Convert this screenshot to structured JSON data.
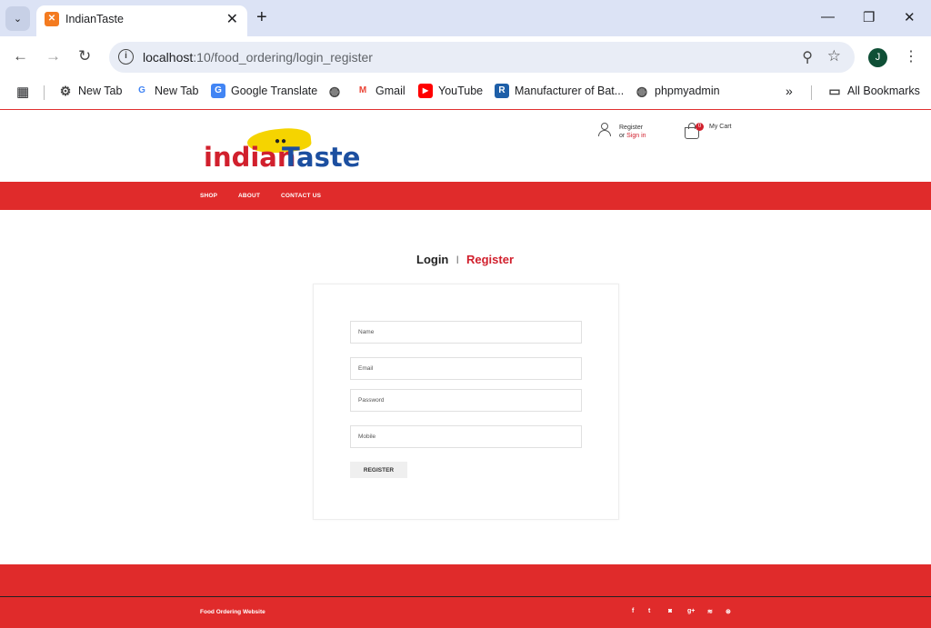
{
  "browser": {
    "tab_title": "IndianTaste",
    "url_host": "localhost",
    "url_path": ":10/food_ordering/login_register",
    "profile_initial": "J",
    "bookmarks": [
      {
        "label": "New Tab",
        "icon": "gear-icon"
      },
      {
        "label": "New Tab",
        "icon": "google-icon"
      },
      {
        "label": "Google Translate",
        "icon": "translate-icon"
      },
      {
        "label": "",
        "icon": "globe-icon"
      },
      {
        "label": "Gmail",
        "icon": "gmail-icon"
      },
      {
        "label": "YouTube",
        "icon": "youtube-icon"
      },
      {
        "label": "Manufacturer of Bat...",
        "icon": "r-icon"
      },
      {
        "label": "phpmyadmin",
        "icon": "globe-icon"
      }
    ],
    "all_bookmarks": "All Bookmarks"
  },
  "header": {
    "logo_part1": "indian",
    "logo_part2": "Taste",
    "register": "Register",
    "or": "or ",
    "sign_in": "Sign in",
    "cart_count": "0",
    "cart_label": "My Cart"
  },
  "nav": {
    "shop": "SHOP",
    "about": "ABOUT",
    "contact": "CONTACT US"
  },
  "auth_tabs": {
    "login": "Login",
    "separator": "|",
    "register": "Register"
  },
  "form": {
    "name_placeholder": "Name",
    "email_placeholder": "Email",
    "password_placeholder": "Password",
    "mobile_placeholder": "Mobile",
    "submit": "REGISTER"
  },
  "footer": {
    "text": "Food Ordering Website",
    "social": [
      "f",
      "t",
      "ig",
      "g+",
      "rss",
      "p"
    ]
  },
  "colors": {
    "brand_red": "#e02b2b",
    "logo_blue": "#1c4fa0",
    "logo_yellow": "#f5d400"
  }
}
